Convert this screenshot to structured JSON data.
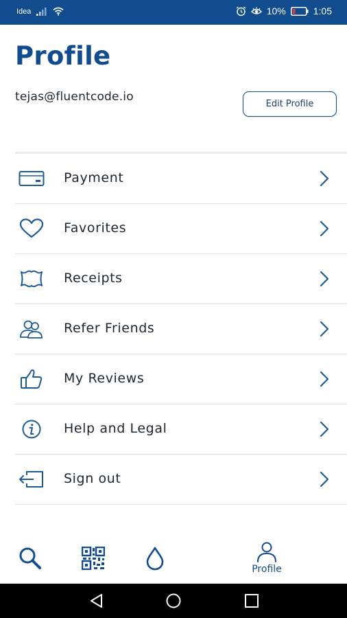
{
  "status_bar": {
    "carrier": "Idea",
    "battery": "10%",
    "time": "1:05"
  },
  "header": {
    "title": "Profile",
    "email": "tejas@fluentcode.io",
    "edit_button_label": "Edit Profile"
  },
  "menu": {
    "items": [
      {
        "label": "Payment",
        "icon": "card-icon"
      },
      {
        "label": "Favorites",
        "icon": "heart-icon"
      },
      {
        "label": "Receipts",
        "icon": "receipt-icon"
      },
      {
        "label": "Refer Friends",
        "icon": "people-icon"
      },
      {
        "label": "My Reviews",
        "icon": "thumbs-up-icon"
      },
      {
        "label": "Help and Legal",
        "icon": "info-icon"
      },
      {
        "label": "Sign out",
        "icon": "sign-out-icon"
      }
    ]
  },
  "bottom_nav": {
    "items": [
      {
        "icon": "search-icon",
        "label": ""
      },
      {
        "icon": "qr-code-icon",
        "label": ""
      },
      {
        "icon": "drop-icon",
        "label": ""
      },
      {
        "icon": "profile-icon",
        "label": "Profile",
        "active": true
      }
    ]
  },
  "colors": {
    "brand": "#114c8f",
    "icon_blue": "#1b5a94",
    "divider": "#dde1e5",
    "text": "#1c2530"
  }
}
